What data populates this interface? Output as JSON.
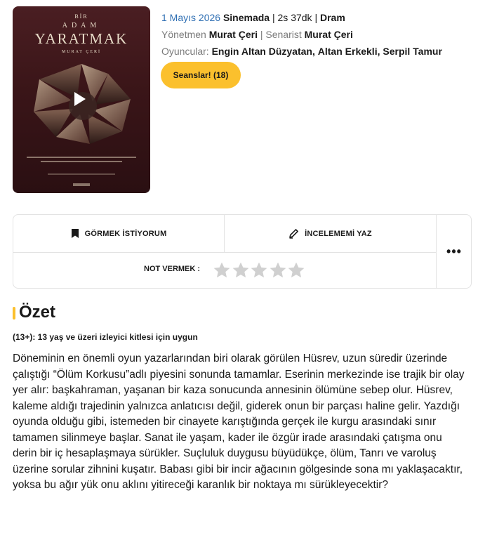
{
  "poster": {
    "line1": "BİR",
    "line2": "ADAM",
    "title": "YARATMAK",
    "director_credit": "MURAT ÇERİ"
  },
  "meta": {
    "date": "1 Mayıs 2026",
    "status": "Sinemada",
    "duration": "2s 37dk",
    "genre": "Dram",
    "director_label": "Yönetmen",
    "director": "Murat Çeri",
    "writer_label": "Senarist",
    "writer": "Murat Çeri",
    "cast_label": "Oyuncular:",
    "cast": [
      "Engin Altan Düzyatan",
      "Altan Erkekli",
      "Serpil Tamur"
    ],
    "separator": "|"
  },
  "buttons": {
    "sessions": "Seanslar! (18)",
    "watchlist": "GÖRMEK İSTİYORUM",
    "review": "İNCELEMEMİ YAZ",
    "more": "•••"
  },
  "rating": {
    "label": "NOT VERMEK :",
    "value": 0,
    "max": 5,
    "star_empty_color": "#d0d0d0"
  },
  "summary": {
    "heading": "Özet",
    "age_rating": "(13+): 13 yaş ve üzeri izleyici kitlesi için uygun",
    "text": "Döneminin en önemli oyun yazarlarından biri olarak görülen Hüsrev, uzun süredir üzerinde çalıştığı “Ölüm Korkusu”adlı piyesini sonunda tamamlar. Eserinin merkezinde ise trajik bir olay yer alır: başkahraman, yaşanan bir kaza sonucunda annesinin ölümüne sebep olur. Hüsrev, kaleme aldığı trajedinin yalnızca anlatıcısı değil, giderek onun bir parçası haline gelir. Yazdığı oyunda olduğu gibi, istemeden bir cinayete karıştığında gerçek ile kurgu arasındaki sınır tamamen silinmeye başlar. Sanat ile yaşam, kader ile özgür irade arasındaki çatışma onu derin bir iç hesaplaşmaya sürükler. Suçluluk duygusu büyüdükçe, ölüm, Tanrı ve varoluş üzerine sorular zihnini kuşatır. Babası gibi bir incir ağacının gölgesinde sona mı yaklaşacaktır, yoksa bu ağır yük onu aklını yitireceği karanlık bir noktaya mı sürükleyecektir?"
  },
  "colors": {
    "accent": "#fbc02d",
    "link_blue": "#2f6fb3",
    "muted": "#7a7a7a",
    "border": "#e3e3e3"
  }
}
